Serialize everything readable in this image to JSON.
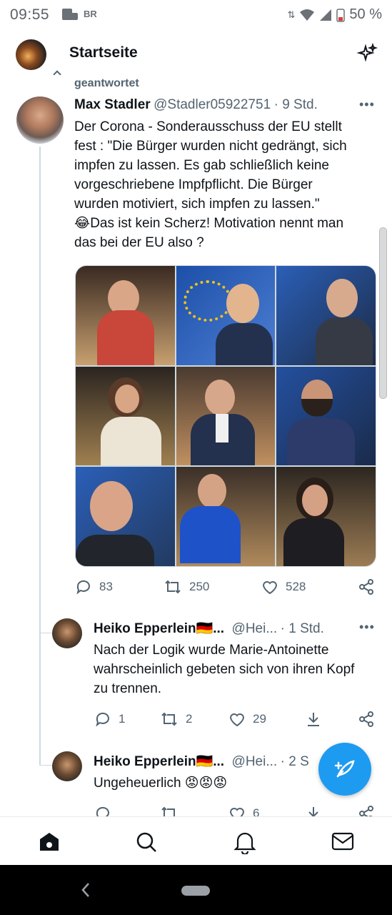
{
  "status_bar": {
    "time": "09:55",
    "br_badge": "BR",
    "battery": "50 %"
  },
  "header": {
    "title": "Startseite"
  },
  "tweet": {
    "retweet_label": "geantwortet",
    "author": "Max Stadler",
    "handle": "@Stadler05922751",
    "time": "· 9 Std.",
    "text_lines": [
      "Der Corona - Sonderausschuss der EU stellt",
      "fest : \"Die Bürger wurden nicht gedrängt, sich",
      "impfen zu lassen. Es gab schließlich keine",
      "vorgeschriebene Impfpflicht. Die Bürger",
      "wurden motiviert, sich impfen zu lassen.\"",
      "😂Das ist kein Scherz! Motivation nennt man",
      "das bei der EU also ?"
    ],
    "actions": {
      "replies": "83",
      "retweets": "250",
      "likes": "528"
    }
  },
  "replies": [
    {
      "author": "Heiko Epperlein🇩🇪...",
      "handle": "@Hei...",
      "time": "· 1 Std.",
      "text_lines": [
        "Nach der Logik wurde Marie-Antoinette",
        "wahrscheinlich gebeten sich von ihren Kopf",
        "zu trennen."
      ],
      "actions": {
        "replies": "1",
        "retweets": "2",
        "likes": "29"
      }
    },
    {
      "author": "Heiko Epperlein🇩🇪...",
      "handle": "@Hei...",
      "time": "· 2 S",
      "text_lines": [
        "Ungeheuerlich 😡😡😡"
      ],
      "actions": {
        "likes": "6"
      }
    }
  ],
  "colors": {
    "accent": "#1d9bf0",
    "muted": "#536471"
  },
  "icons": {
    "header_action": "sparkle-icon",
    "fab": "compose-feather-icon"
  }
}
